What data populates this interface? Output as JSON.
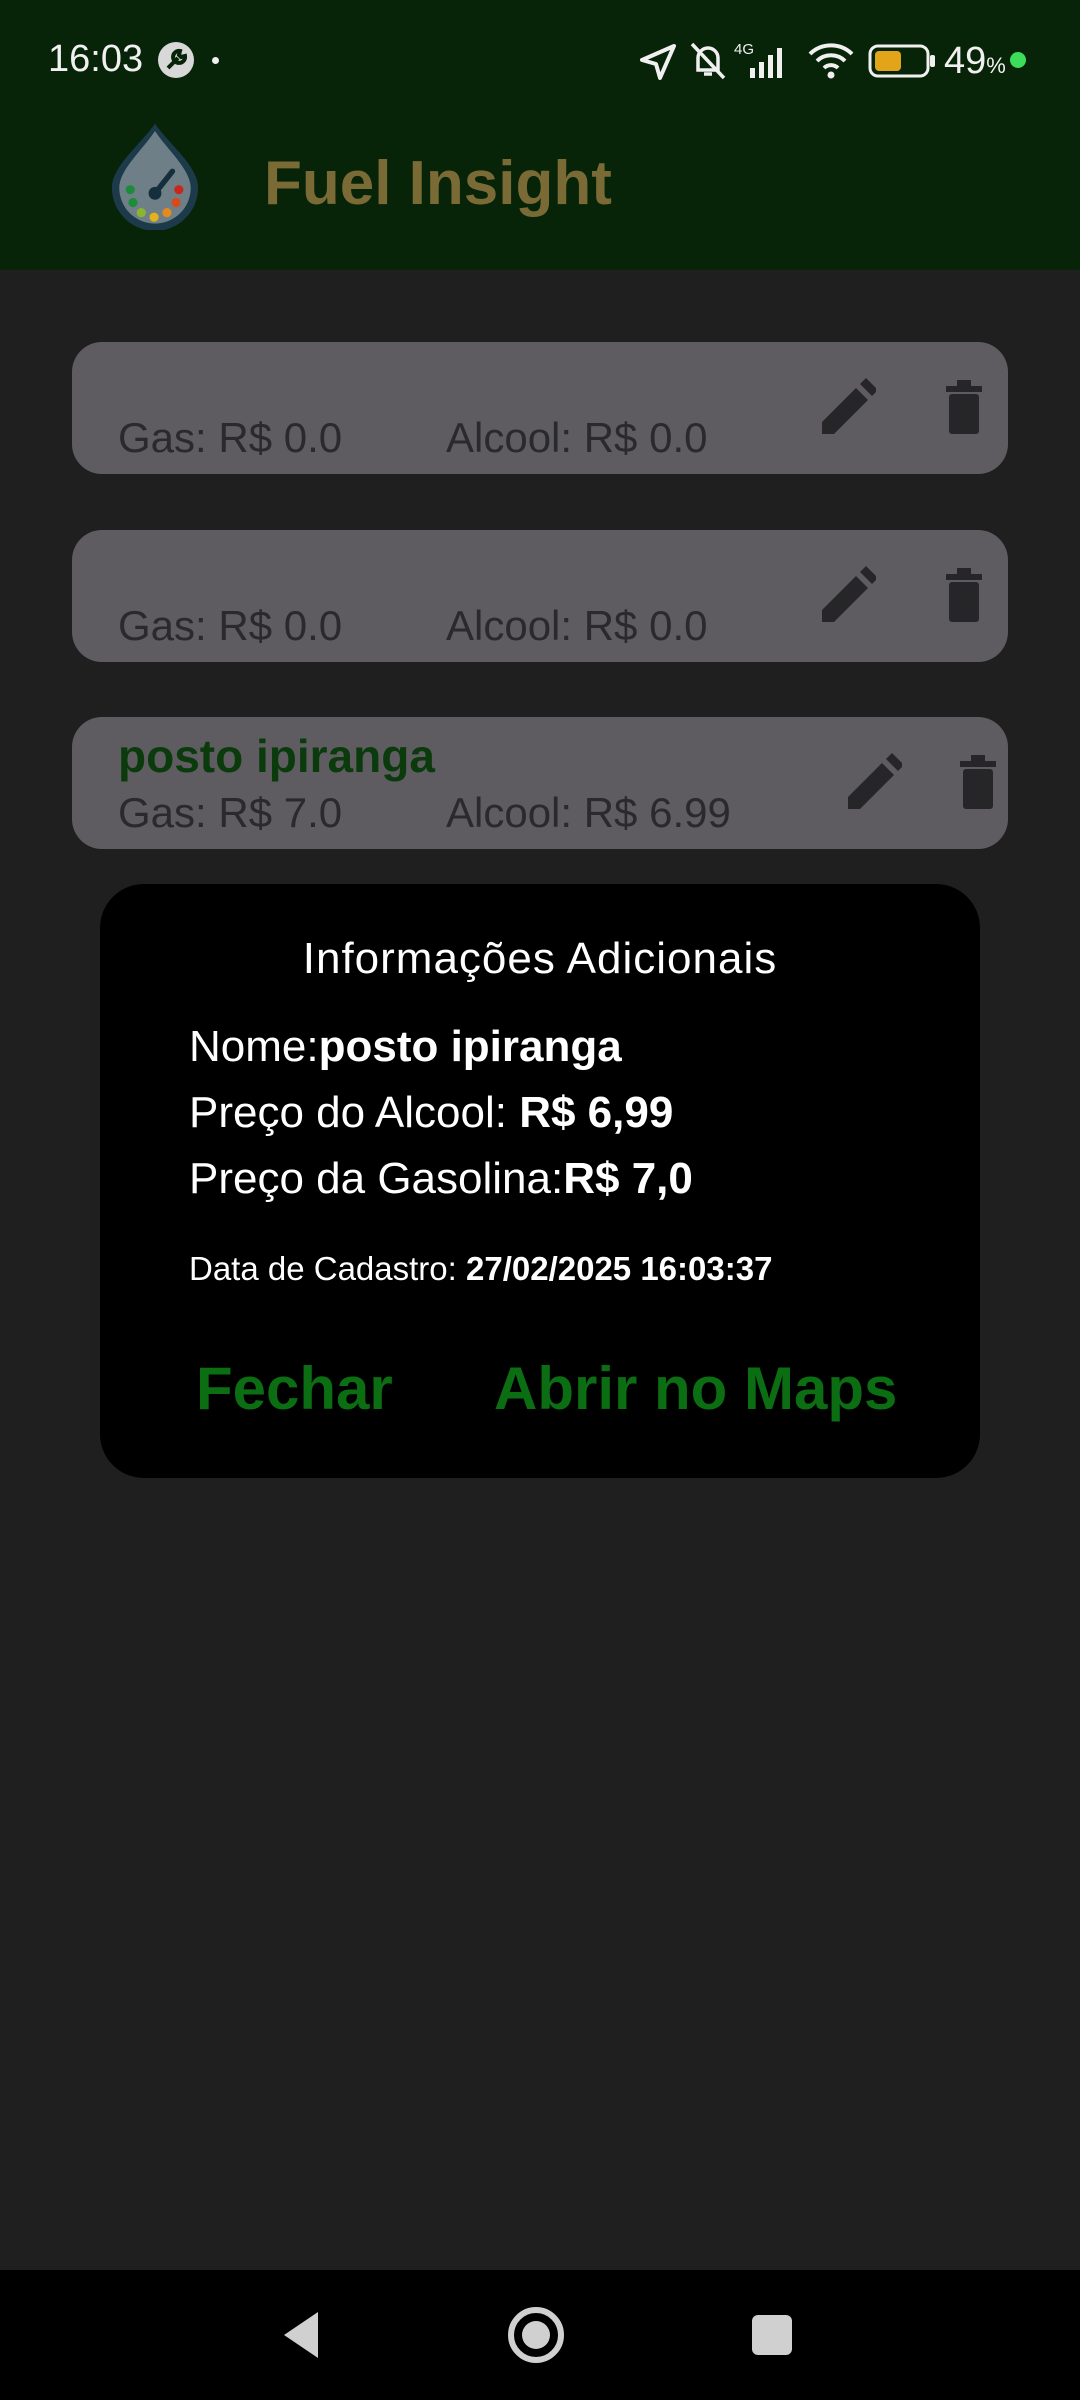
{
  "status_bar": {
    "time": "16:03",
    "battery_value": "49",
    "battery_unit": "%",
    "network": "4G"
  },
  "app_bar": {
    "title": "Fuel Insight",
    "title_color": "#7a6a35",
    "background": "#072308"
  },
  "stations": [
    {
      "name": "",
      "gas_label": "Gas: R$ 0.0",
      "alcool_label": "Alcool: R$ 0.0"
    },
    {
      "name": "",
      "gas_label": "Gas: R$ 0.0",
      "alcool_label": "Alcool: R$ 0.0"
    },
    {
      "name": "posto ipiranga",
      "gas_label": "Gas: R$ 7.0",
      "alcool_label": "Alcool: R$ 6.99"
    }
  ],
  "dialog": {
    "title": "Informações Adicionais",
    "name_label": "Nome:",
    "name_value": "posto ipiranga",
    "alcool_label": "Preço do Alcool: ",
    "alcool_value": "R$ 6,99",
    "gasolina_label": "Preço da Gasolina:",
    "gasolina_value": "R$ 7,0",
    "date_label": "Data de Cadastro: ",
    "date_value": "27/02/2025 16:03:37",
    "close_button": "Fechar",
    "maps_button": "Abrir no Maps",
    "accent": "#0c6e12"
  },
  "icons": {
    "edit": "pencil-icon",
    "delete": "trash-icon",
    "logo": "fuel-gauge-drop-icon"
  }
}
